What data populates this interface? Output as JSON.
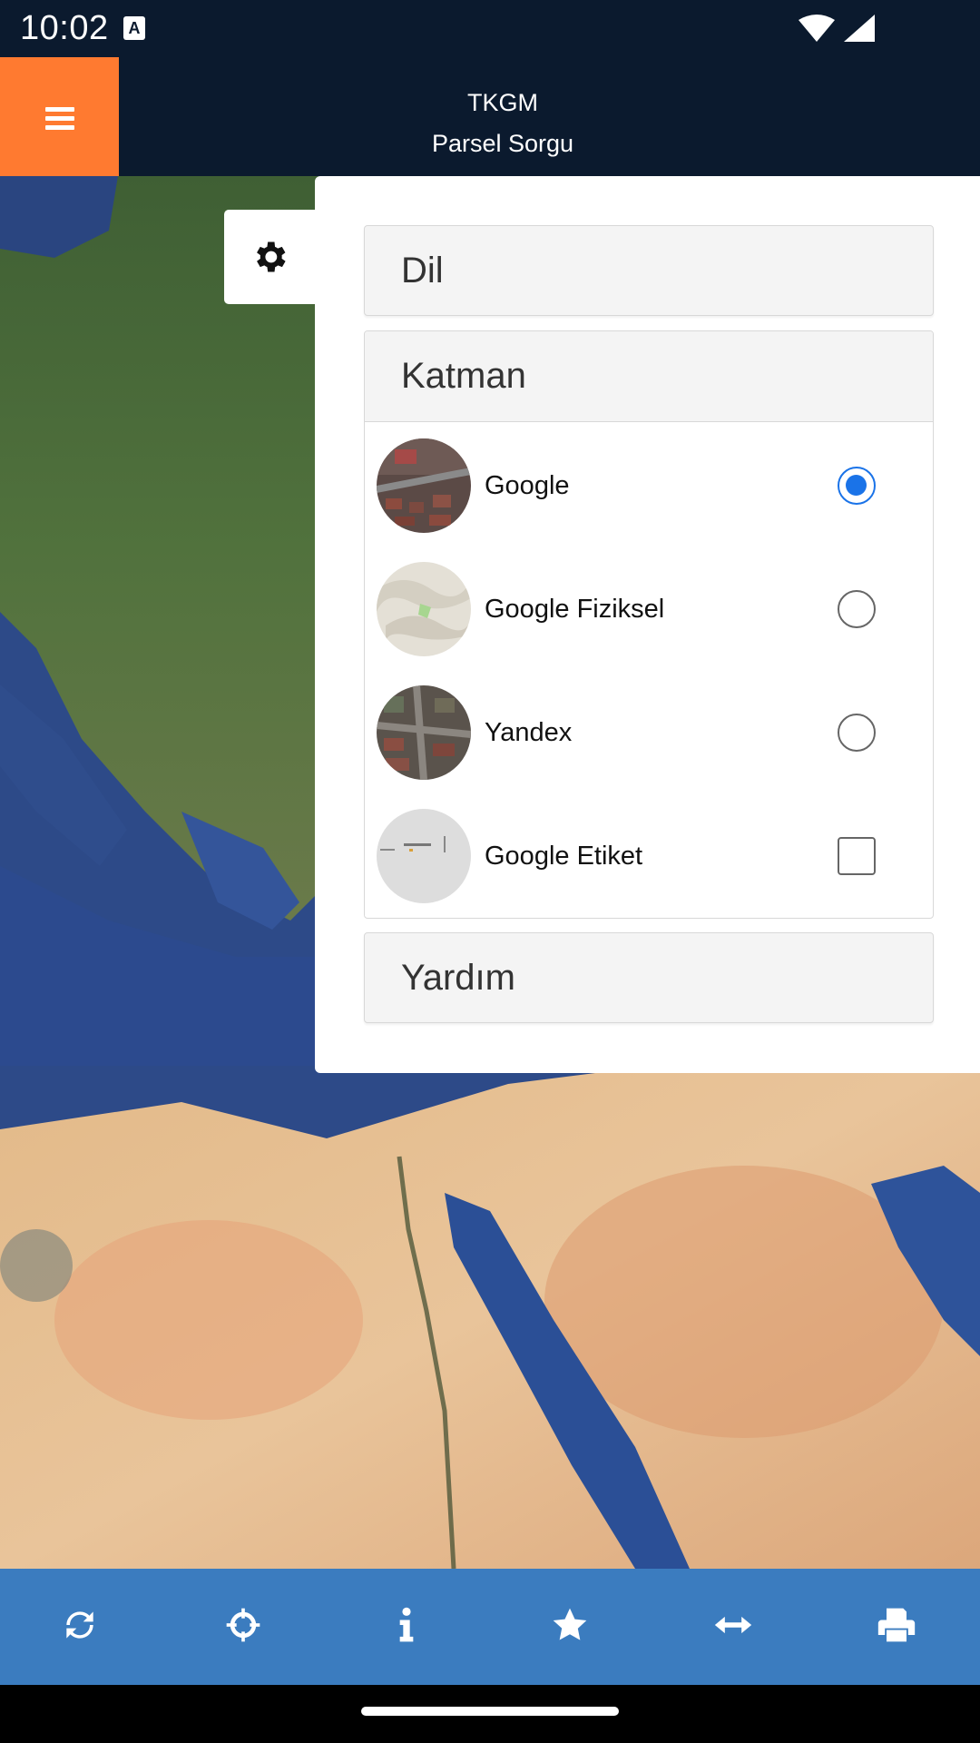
{
  "status_bar": {
    "time": "10:02",
    "notification_glyph": "A",
    "icons": [
      "wifi-icon",
      "cell-signal-icon"
    ]
  },
  "header": {
    "menu_icon": "hamburger-menu-icon",
    "title_line1": "TKGM",
    "title_line2": "Parsel Sorgu",
    "menu_color": "#ff7a30",
    "background": "#0b1a2e"
  },
  "settings_tab": {
    "icon": "gear-icon"
  },
  "panel": {
    "sections": {
      "language": "Dil",
      "layers": "Katman",
      "help": "Yardım"
    },
    "layers": [
      {
        "label": "Google",
        "control": "radio",
        "checked": true,
        "thumb": "satellite"
      },
      {
        "label": "Google Fiziksel",
        "control": "radio",
        "checked": false,
        "thumb": "terrain"
      },
      {
        "label": "Yandex",
        "control": "radio",
        "checked": false,
        "thumb": "satellite"
      },
      {
        "label": "Google Etiket",
        "control": "checkbox",
        "checked": false,
        "thumb": "labels"
      }
    ]
  },
  "toolbar": {
    "background": "#3b7cbf",
    "buttons": [
      "refresh-icon",
      "crosshair-icon",
      "info-icon",
      "star-icon",
      "measure-arrows-icon",
      "print-icon"
    ]
  },
  "accent_color": "#1a73e8"
}
